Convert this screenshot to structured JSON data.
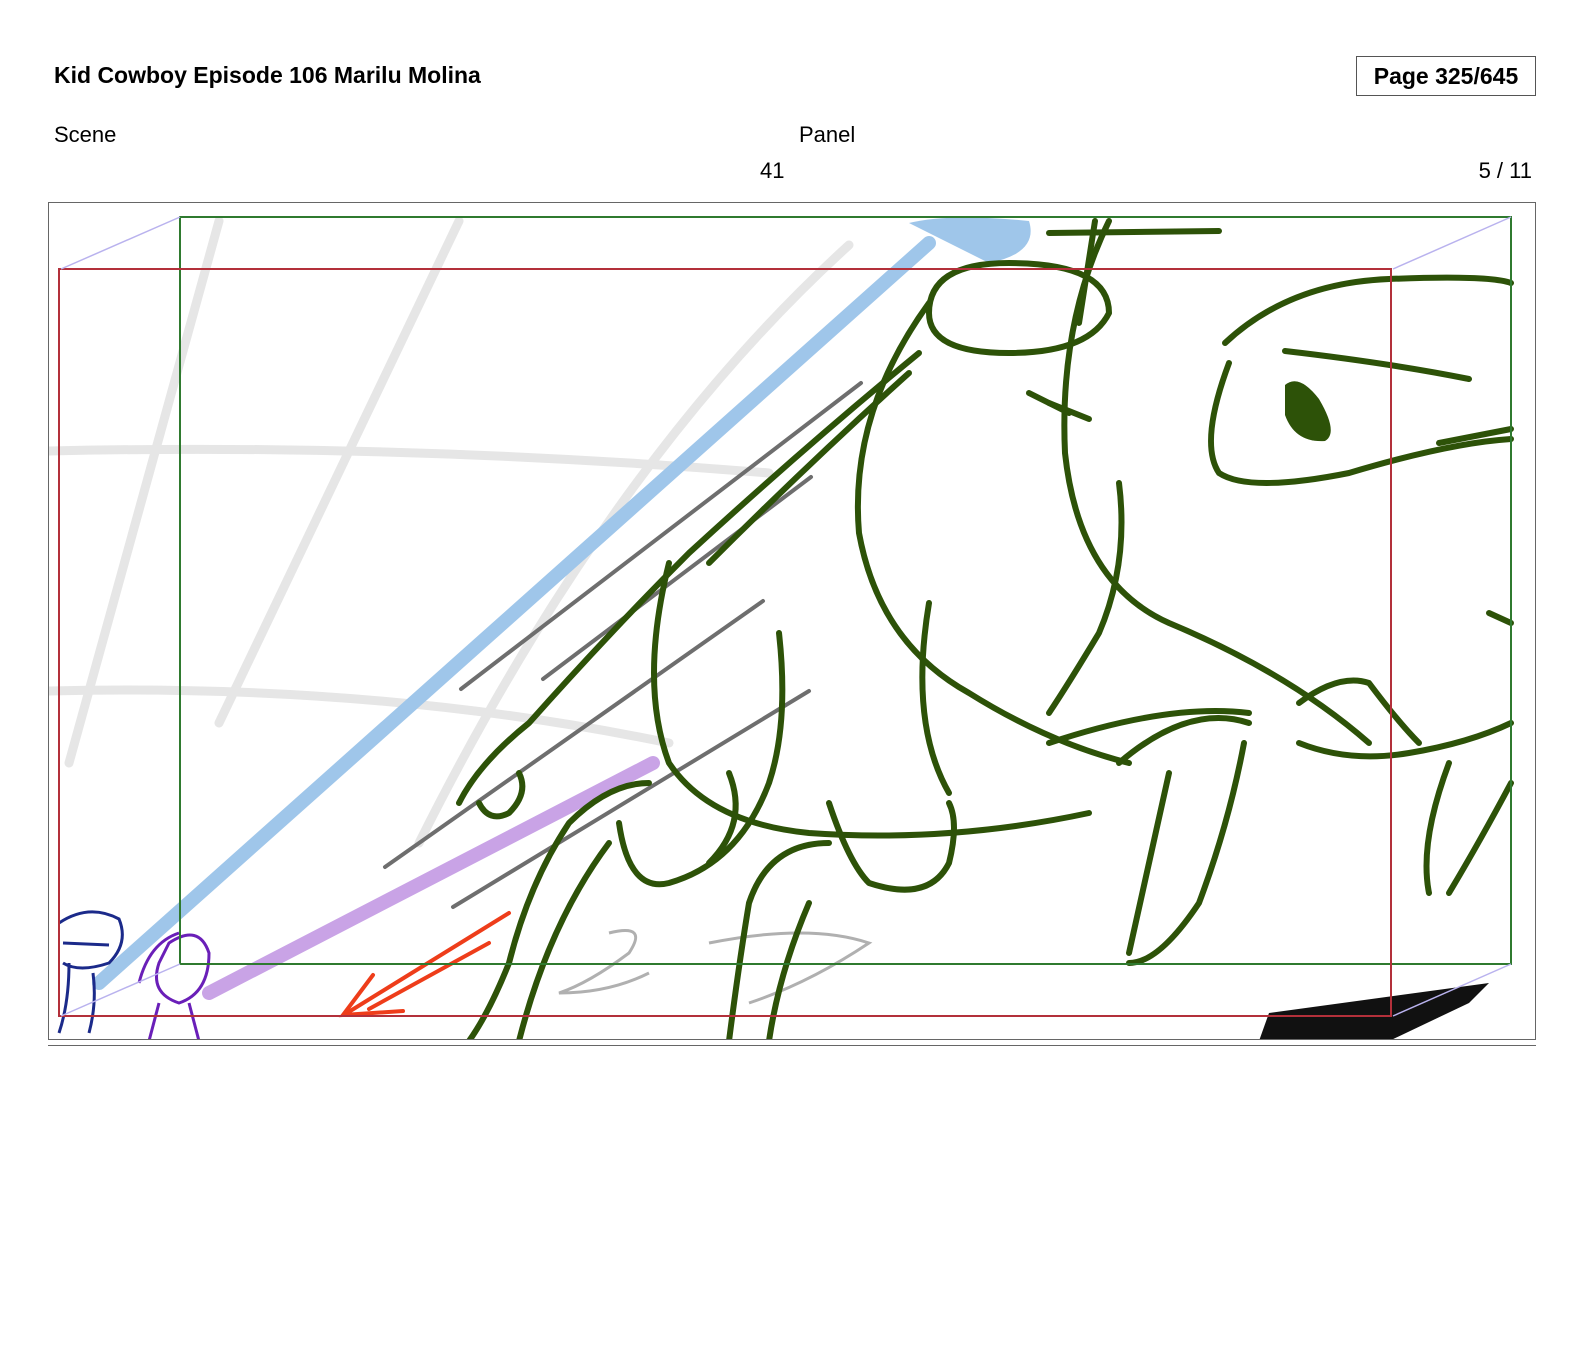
{
  "header": {
    "title": "Kid Cowboy Episode 106 Marilu Molina",
    "page_indicator": "Page 325/645"
  },
  "fields": {
    "scene_label": "Scene",
    "panel_label": "Panel",
    "scene_value": "41",
    "panel_value": "5 / 11"
  },
  "colors": {
    "sketch_green": "#2d5208",
    "safe_frame_green": "#2f7a2f",
    "camera_frame_red": "#b3303a",
    "guide_blue": "#9fc6ea",
    "guide_purple": "#c9a3e6",
    "arrow_red": "#ee3d1a"
  }
}
